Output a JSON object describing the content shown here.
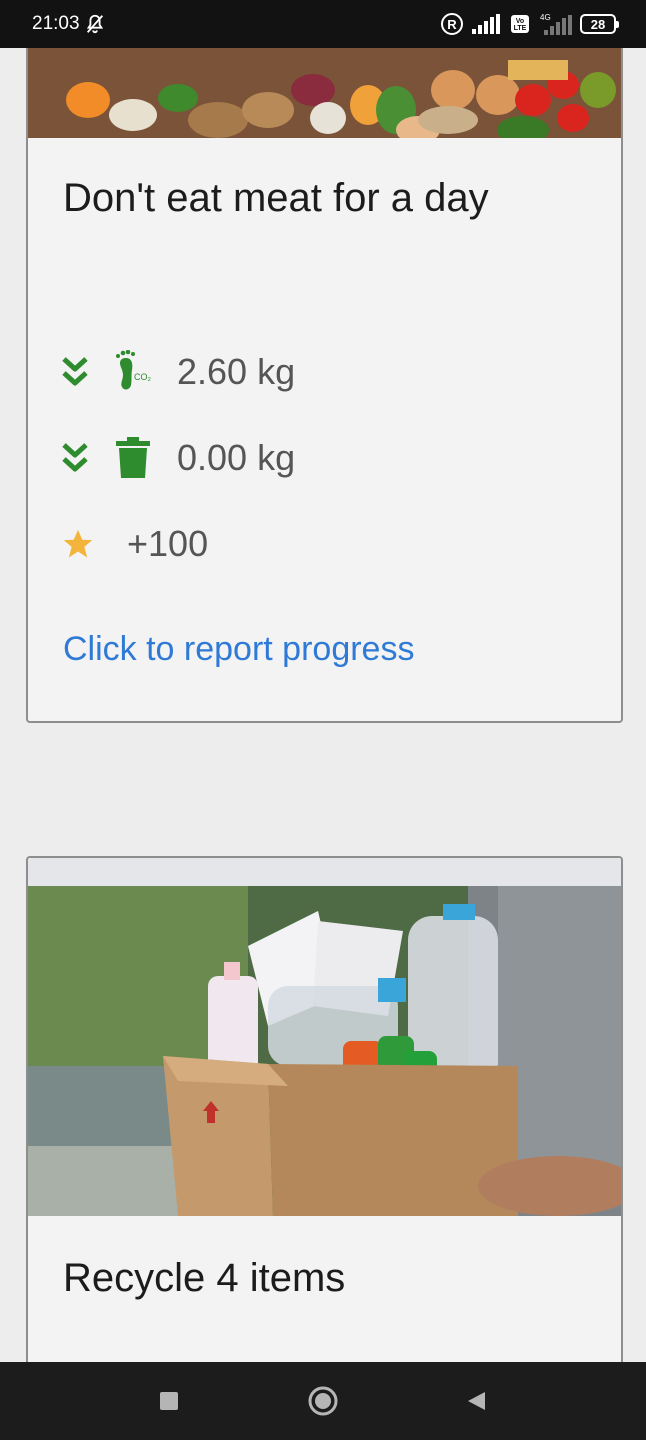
{
  "status_bar": {
    "time": "21:03",
    "battery": "28",
    "icons": [
      "bell-off-icon",
      "registered-icon",
      "signal-icon",
      "volte-icon",
      "signal-4g-icon",
      "battery-icon"
    ]
  },
  "cards": [
    {
      "title": "Don't eat meat for a day",
      "image": "vegetables-image",
      "stats": [
        {
          "icon": "footprint-co2-icon",
          "indicator": "double-chevron-down-icon",
          "value": "2.60 kg"
        },
        {
          "icon": "trash-icon",
          "indicator": "double-chevron-down-icon",
          "value": "0.00 kg"
        },
        {
          "icon": "star-icon",
          "value": "+100"
        }
      ],
      "action_label": "Click to report progress"
    },
    {
      "title": "Recycle 4 items",
      "image": "recycling-box-image"
    }
  ],
  "colors": {
    "accent_green": "#2e8b2e",
    "link_blue": "#2f7ad6",
    "star_yellow": "#f3b43c"
  },
  "nav_bar": {
    "buttons": [
      "recents-button",
      "home-button",
      "back-button"
    ]
  }
}
